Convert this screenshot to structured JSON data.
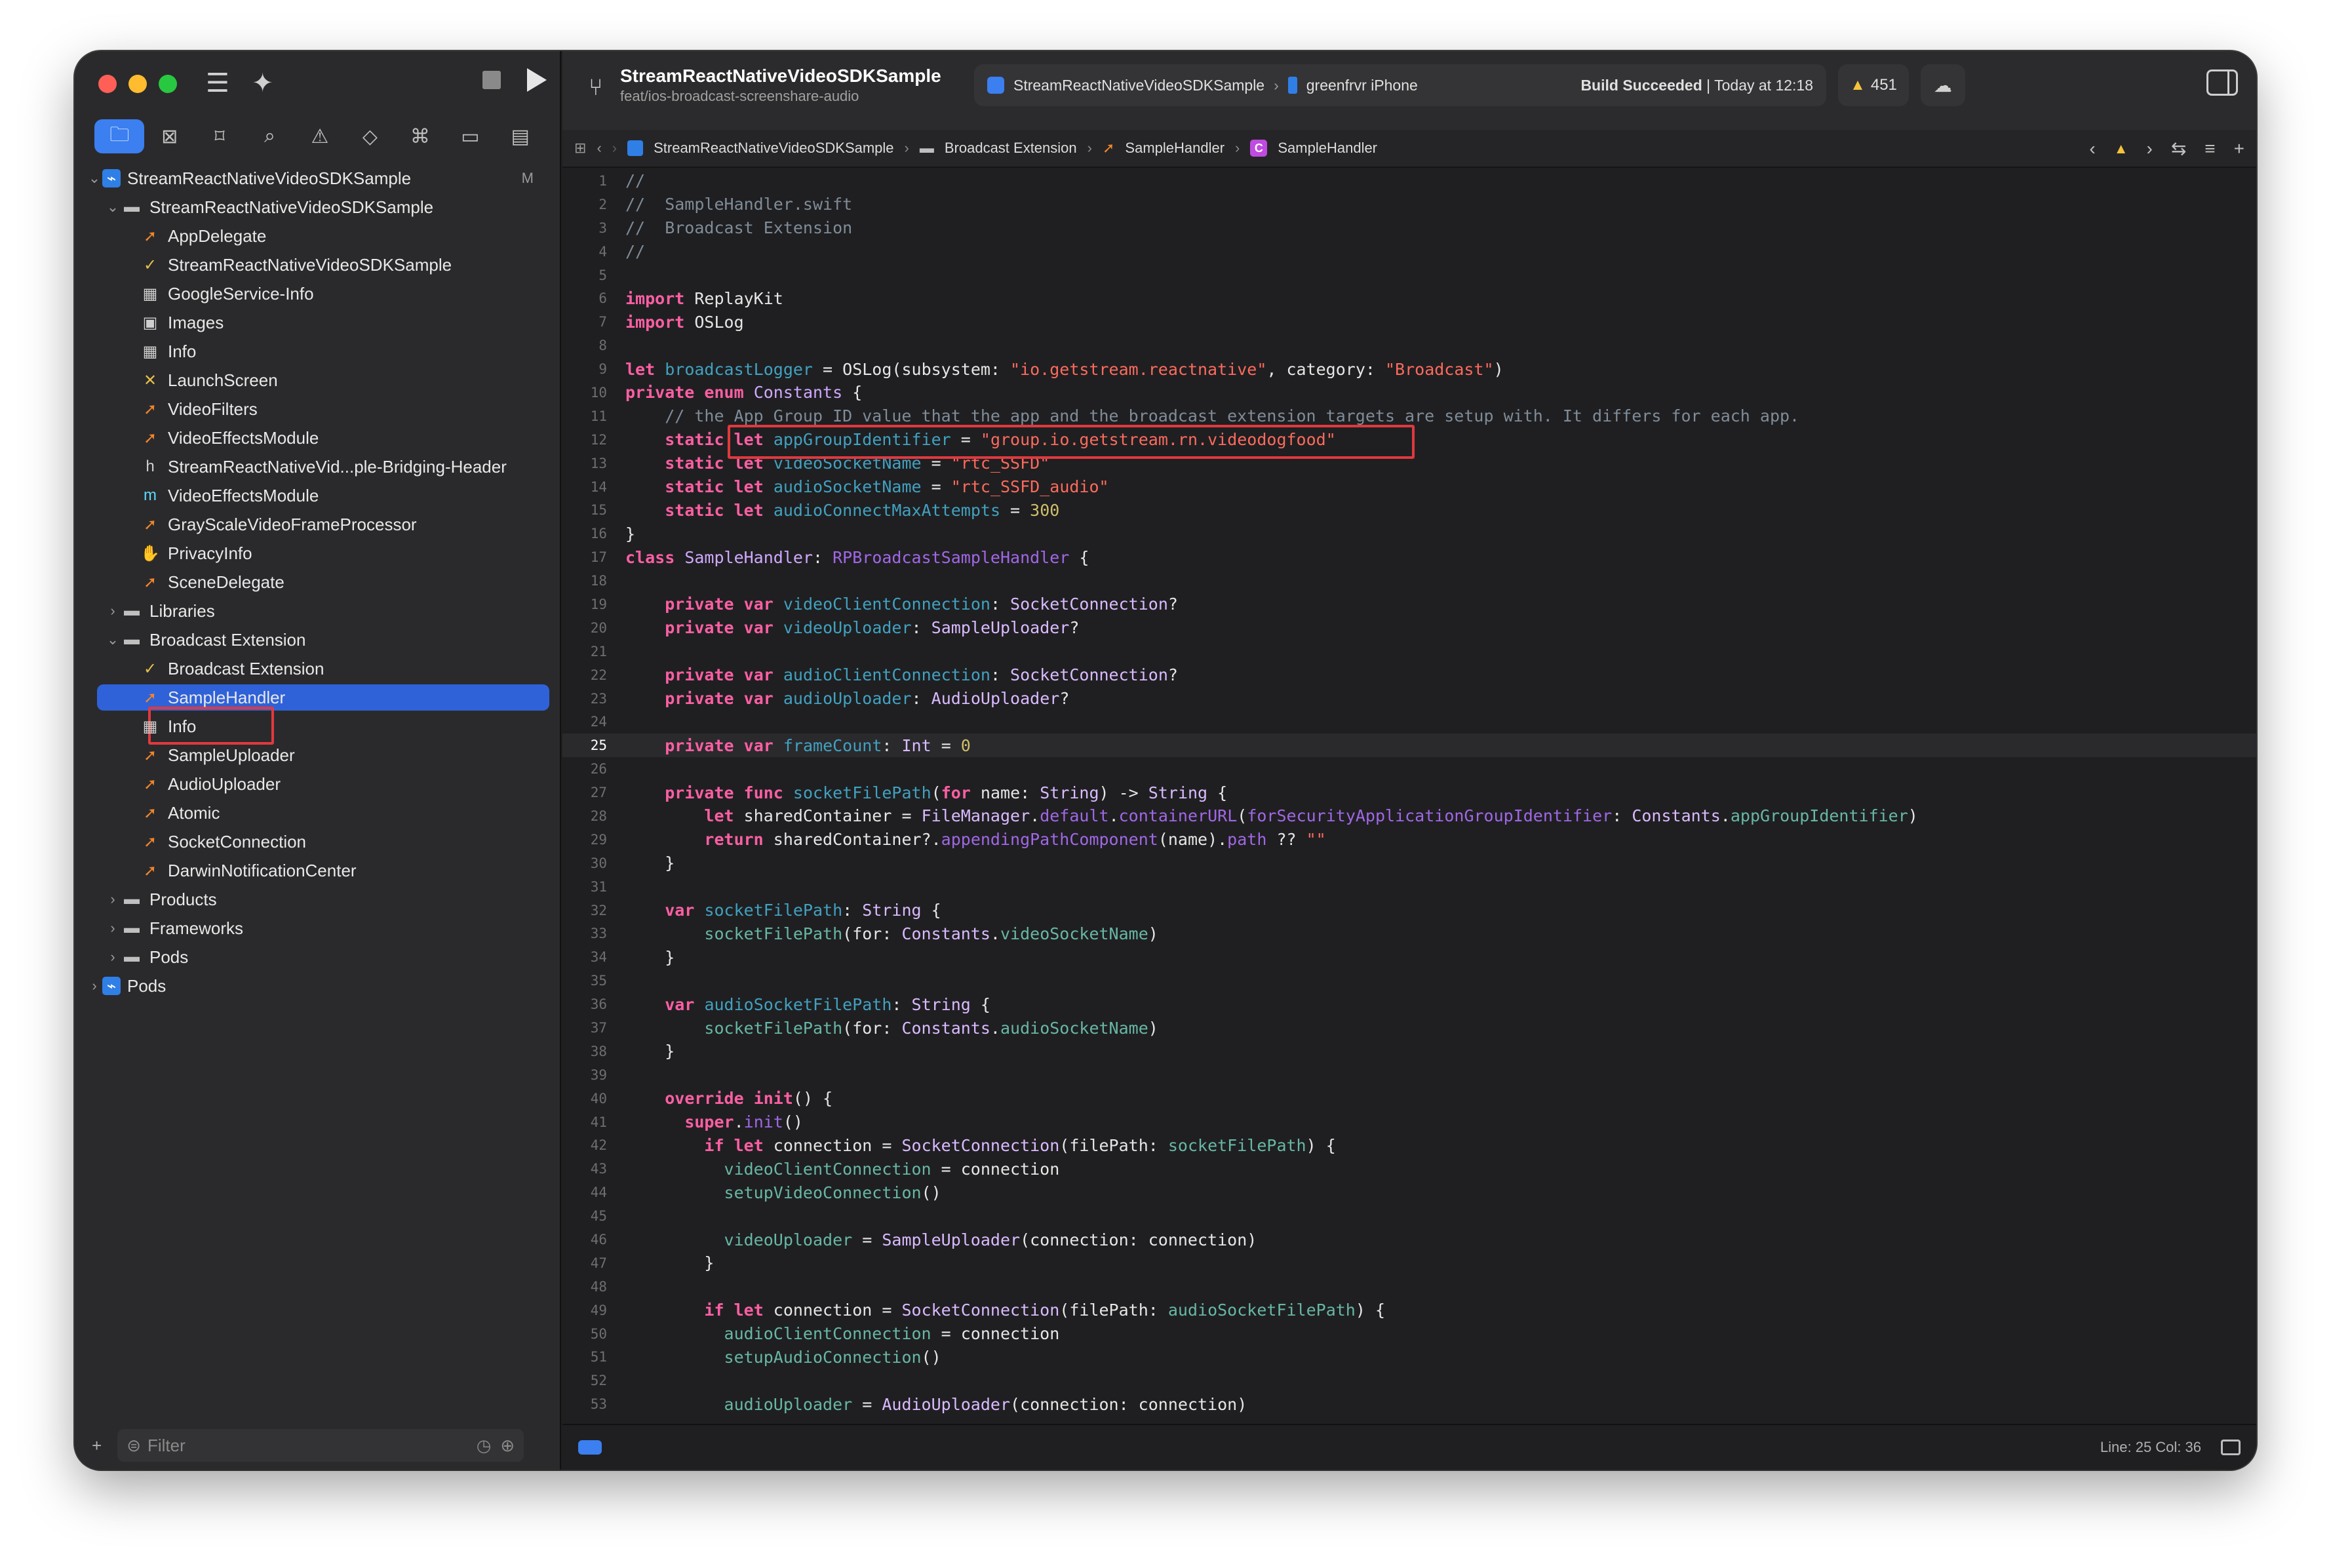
{
  "sidebar": {
    "nav_tabs": [
      {
        "icon": "folder-icon",
        "glyph": "🗀"
      },
      {
        "icon": "source-control-icon",
        "glyph": "⊠"
      },
      {
        "icon": "bookmark-icon",
        "glyph": "⌑"
      },
      {
        "icon": "find-icon",
        "glyph": "⌕"
      },
      {
        "icon": "issue-icon",
        "glyph": "⚠"
      },
      {
        "icon": "test-icon",
        "glyph": "◇"
      },
      {
        "icon": "debug-icon",
        "glyph": "⌘"
      },
      {
        "icon": "breakpoint-icon",
        "glyph": "▭"
      },
      {
        "icon": "report-icon",
        "glyph": "▤"
      }
    ],
    "tree": [
      {
        "label": "StreamReactNativeVideoSDKSample",
        "depth": 0,
        "chev": "⌄",
        "icon": "project-icon",
        "badge": "M"
      },
      {
        "label": "StreamReactNativeVideoSDKSample",
        "depth": 1,
        "chev": "⌄",
        "icon": "folder-icon"
      },
      {
        "label": "AppDelegate",
        "depth": 2,
        "chev": "",
        "icon": "swift-icon"
      },
      {
        "label": "StreamReactNativeVideoSDKSample",
        "depth": 2,
        "chev": "",
        "icon": "entitlements-icon"
      },
      {
        "label": "GoogleService-Info",
        "depth": 2,
        "chev": "",
        "icon": "plist-icon"
      },
      {
        "label": "Images",
        "depth": 2,
        "chev": "",
        "icon": "assets-icon"
      },
      {
        "label": "Info",
        "depth": 2,
        "chev": "",
        "icon": "plist-icon"
      },
      {
        "label": "LaunchScreen",
        "depth": 2,
        "chev": "",
        "icon": "storyboard-icon"
      },
      {
        "label": "VideoFilters",
        "depth": 2,
        "chev": "",
        "icon": "swift-icon"
      },
      {
        "label": "VideoEffectsModule",
        "depth": 2,
        "chev": "",
        "icon": "swift-icon"
      },
      {
        "label": "StreamReactNativeVid...ple-Bridging-Header",
        "depth": 2,
        "chev": "",
        "icon": "header-icon"
      },
      {
        "label": "VideoEffectsModule",
        "depth": 2,
        "chev": "",
        "icon": "objc-icon"
      },
      {
        "label": "GrayScaleVideoFrameProcessor",
        "depth": 2,
        "chev": "",
        "icon": "swift-icon"
      },
      {
        "label": "PrivacyInfo",
        "depth": 2,
        "chev": "",
        "icon": "privacy-icon"
      },
      {
        "label": "SceneDelegate",
        "depth": 2,
        "chev": "",
        "icon": "swift-icon"
      },
      {
        "label": "Libraries",
        "depth": 1,
        "chev": "›",
        "icon": "folder-icon"
      },
      {
        "label": "Broadcast Extension",
        "depth": 1,
        "chev": "⌄",
        "icon": "folder-icon"
      },
      {
        "label": "Broadcast Extension",
        "depth": 2,
        "chev": "",
        "icon": "entitlements-icon"
      },
      {
        "label": "SampleHandler",
        "depth": 2,
        "chev": "",
        "icon": "swift-icon",
        "selected": true
      },
      {
        "label": "Info",
        "depth": 2,
        "chev": "",
        "icon": "plist-icon"
      },
      {
        "label": "SampleUploader",
        "depth": 2,
        "chev": "",
        "icon": "swift-icon"
      },
      {
        "label": "AudioUploader",
        "depth": 2,
        "chev": "",
        "icon": "swift-icon"
      },
      {
        "label": "Atomic",
        "depth": 2,
        "chev": "",
        "icon": "swift-icon"
      },
      {
        "label": "SocketConnection",
        "depth": 2,
        "chev": "",
        "icon": "swift-icon"
      },
      {
        "label": "DarwinNotificationCenter",
        "depth": 2,
        "chev": "",
        "icon": "swift-icon"
      },
      {
        "label": "Products",
        "depth": 1,
        "chev": "›",
        "icon": "folder-icon"
      },
      {
        "label": "Frameworks",
        "depth": 1,
        "chev": "›",
        "icon": "folder-icon"
      },
      {
        "label": "Pods",
        "depth": 1,
        "chev": "›",
        "icon": "folder-icon"
      },
      {
        "label": "Pods",
        "depth": 0,
        "chev": "›",
        "icon": "project-icon"
      }
    ],
    "filter_placeholder": "Filter"
  },
  "toolbar": {
    "project_title": "StreamReactNativeVideoSDKSample",
    "branch": "feat/ios-broadcast-screenshare-audio",
    "scheme": "StreamReactNativeVideoSDKSample",
    "device": "greenfrvr iPhone",
    "build_status_bold": "Build Succeeded",
    "build_status_time": " | Today at 12:18",
    "warnings_count": "451"
  },
  "jumpbar": {
    "project": "StreamReactNativeVideoSDKSample",
    "folder": "Broadcast Extension",
    "file": "SampleHandler",
    "symbol": "SampleHandler",
    "symbol_badge": "C"
  },
  "editor": {
    "current_line": 25,
    "lines": [
      [
        [
          "cm",
          "//"
        ]
      ],
      [
        [
          "cm",
          "//  SampleHandler.swift"
        ]
      ],
      [
        [
          "cm",
          "//  Broadcast Extension"
        ]
      ],
      [
        [
          "cm",
          "//"
        ]
      ],
      [],
      [
        [
          "kw",
          "import"
        ],
        [
          "p",
          " ReplayKit"
        ]
      ],
      [
        [
          "kw",
          "import"
        ],
        [
          "p",
          " OSLog"
        ]
      ],
      [],
      [
        [
          "kw",
          "let"
        ],
        [
          "p",
          " "
        ],
        [
          "dec",
          "broadcastLogger"
        ],
        [
          "p",
          " = OSLog(subsystem: "
        ],
        [
          "str",
          "\"io.getstream.reactnative\""
        ],
        [
          "p",
          ", category: "
        ],
        [
          "str",
          "\"Broadcast\""
        ],
        [
          "p",
          ")"
        ]
      ],
      [
        [
          "kw",
          "private"
        ],
        [
          "p",
          " "
        ],
        [
          "kw",
          "enum"
        ],
        [
          "p",
          " "
        ],
        [
          "ty",
          "Constants"
        ],
        [
          "p",
          " {"
        ]
      ],
      [
        [
          "cm",
          "    // the App Group ID value that the app and the broadcast extension targets are setup with. It differs for each app."
        ]
      ],
      [
        [
          "p",
          "    "
        ],
        [
          "kw",
          "static"
        ],
        [
          "p",
          " "
        ],
        [
          "kw",
          "let"
        ],
        [
          "p",
          " "
        ],
        [
          "dec",
          "appGroupIdentifier"
        ],
        [
          "p",
          " = "
        ],
        [
          "str",
          "\"group.io.getstream.rn.videodogfood\""
        ]
      ],
      [
        [
          "p",
          "    "
        ],
        [
          "kw",
          "static"
        ],
        [
          "p",
          " "
        ],
        [
          "kw",
          "let"
        ],
        [
          "p",
          " "
        ],
        [
          "dec",
          "videoSocketName"
        ],
        [
          "p",
          " = "
        ],
        [
          "str",
          "\"rtc_SSFD\""
        ]
      ],
      [
        [
          "p",
          "    "
        ],
        [
          "kw",
          "static"
        ],
        [
          "p",
          " "
        ],
        [
          "kw",
          "let"
        ],
        [
          "p",
          " "
        ],
        [
          "dec",
          "audioSocketName"
        ],
        [
          "p",
          " = "
        ],
        [
          "str",
          "\"rtc_SSFD_audio\""
        ]
      ],
      [
        [
          "p",
          "    "
        ],
        [
          "kw",
          "static"
        ],
        [
          "p",
          " "
        ],
        [
          "kw",
          "let"
        ],
        [
          "p",
          " "
        ],
        [
          "dec",
          "audioConnectMaxAttempts"
        ],
        [
          "p",
          " = "
        ],
        [
          "num",
          "300"
        ]
      ],
      [
        [
          "p",
          "}"
        ]
      ],
      [
        [
          "kw",
          "class"
        ],
        [
          "p",
          " "
        ],
        [
          "ty",
          "SampleHandler"
        ],
        [
          "p",
          ": "
        ],
        [
          "tyd",
          "RPBroadcastSampleHandler"
        ],
        [
          "p",
          " {"
        ]
      ],
      [],
      [
        [
          "p",
          "    "
        ],
        [
          "kw",
          "private"
        ],
        [
          "p",
          " "
        ],
        [
          "kw",
          "var"
        ],
        [
          "p",
          " "
        ],
        [
          "dec",
          "videoClientConnection"
        ],
        [
          "p",
          ": "
        ],
        [
          "ty2",
          "SocketConnection"
        ],
        [
          "p",
          "?"
        ]
      ],
      [
        [
          "p",
          "    "
        ],
        [
          "kw",
          "private"
        ],
        [
          "p",
          " "
        ],
        [
          "kw",
          "var"
        ],
        [
          "p",
          " "
        ],
        [
          "dec",
          "videoUploader"
        ],
        [
          "p",
          ": "
        ],
        [
          "ty2",
          "SampleUploader"
        ],
        [
          "p",
          "?"
        ]
      ],
      [],
      [
        [
          "p",
          "    "
        ],
        [
          "kw",
          "private"
        ],
        [
          "p",
          " "
        ],
        [
          "kw",
          "var"
        ],
        [
          "p",
          " "
        ],
        [
          "dec",
          "audioClientConnection"
        ],
        [
          "p",
          ": "
        ],
        [
          "ty2",
          "SocketConnection"
        ],
        [
          "p",
          "?"
        ]
      ],
      [
        [
          "p",
          "    "
        ],
        [
          "kw",
          "private"
        ],
        [
          "p",
          " "
        ],
        [
          "kw",
          "var"
        ],
        [
          "p",
          " "
        ],
        [
          "dec",
          "audioUploader"
        ],
        [
          "p",
          ": "
        ],
        [
          "ty2",
          "AudioUploader"
        ],
        [
          "p",
          "?"
        ]
      ],
      [],
      [
        [
          "p",
          "    "
        ],
        [
          "kw",
          "private"
        ],
        [
          "p",
          " "
        ],
        [
          "kw",
          "var"
        ],
        [
          "p",
          " "
        ],
        [
          "dec",
          "frameCount"
        ],
        [
          "p",
          ": "
        ],
        [
          "ty2",
          "Int"
        ],
        [
          "p",
          " = "
        ],
        [
          "num",
          "0"
        ]
      ],
      [],
      [
        [
          "p",
          "    "
        ],
        [
          "kw",
          "private"
        ],
        [
          "p",
          " "
        ],
        [
          "kw",
          "func"
        ],
        [
          "p",
          " "
        ],
        [
          "dec",
          "socketFilePath"
        ],
        [
          "p",
          "("
        ],
        [
          "kw",
          "for"
        ],
        [
          "p",
          " name: "
        ],
        [
          "ty2",
          "String"
        ],
        [
          "p",
          ") -> "
        ],
        [
          "ty2",
          "String"
        ],
        [
          "p",
          " {"
        ]
      ],
      [
        [
          "p",
          "        "
        ],
        [
          "kw",
          "let"
        ],
        [
          "p",
          " sharedContainer = "
        ],
        [
          "ty2",
          "FileManager"
        ],
        [
          "p",
          "."
        ],
        [
          "fn",
          "default"
        ],
        [
          "p",
          "."
        ],
        [
          "fn",
          "containerURL"
        ],
        [
          "p",
          "("
        ],
        [
          "fn",
          "forSecurityApplicationGroupIdentifier"
        ],
        [
          "p",
          ": "
        ],
        [
          "ty2",
          "Constants"
        ],
        [
          "p",
          "."
        ],
        [
          "prop",
          "appGroupIdentifier"
        ],
        [
          "p",
          ")"
        ]
      ],
      [
        [
          "p",
          "        "
        ],
        [
          "kw",
          "return"
        ],
        [
          "p",
          " sharedContainer?."
        ],
        [
          "fn",
          "appendingPathComponent"
        ],
        [
          "p",
          "(name)."
        ],
        [
          "fn",
          "path"
        ],
        [
          "p",
          " ?? "
        ],
        [
          "str",
          "\"\""
        ]
      ],
      [
        [
          "p",
          "    }"
        ]
      ],
      [],
      [
        [
          "p",
          "    "
        ],
        [
          "kw",
          "var"
        ],
        [
          "p",
          " "
        ],
        [
          "dec",
          "socketFilePath"
        ],
        [
          "p",
          ": "
        ],
        [
          "ty2",
          "String"
        ],
        [
          "p",
          " {"
        ]
      ],
      [
        [
          "p",
          "        "
        ],
        [
          "prop",
          "socketFilePath"
        ],
        [
          "p",
          "(for: "
        ],
        [
          "ty2",
          "Constants"
        ],
        [
          "p",
          "."
        ],
        [
          "prop",
          "videoSocketName"
        ],
        [
          "p",
          ")"
        ]
      ],
      [
        [
          "p",
          "    }"
        ]
      ],
      [],
      [
        [
          "p",
          "    "
        ],
        [
          "kw",
          "var"
        ],
        [
          "p",
          " "
        ],
        [
          "dec",
          "audioSocketFilePath"
        ],
        [
          "p",
          ": "
        ],
        [
          "ty2",
          "String"
        ],
        [
          "p",
          " {"
        ]
      ],
      [
        [
          "p",
          "        "
        ],
        [
          "prop",
          "socketFilePath"
        ],
        [
          "p",
          "(for: "
        ],
        [
          "ty2",
          "Constants"
        ],
        [
          "p",
          "."
        ],
        [
          "prop",
          "audioSocketName"
        ],
        [
          "p",
          ")"
        ]
      ],
      [
        [
          "p",
          "    }"
        ]
      ],
      [],
      [
        [
          "p",
          "    "
        ],
        [
          "kw",
          "override"
        ],
        [
          "p",
          " "
        ],
        [
          "kw",
          "init"
        ],
        [
          "p",
          "() {"
        ]
      ],
      [
        [
          "p",
          "      "
        ],
        [
          "kw",
          "super"
        ],
        [
          "p",
          "."
        ],
        [
          "fn",
          "init"
        ],
        [
          "p",
          "()"
        ]
      ],
      [
        [
          "p",
          "        "
        ],
        [
          "kw",
          "if"
        ],
        [
          "p",
          " "
        ],
        [
          "kw",
          "let"
        ],
        [
          "p",
          " connection = "
        ],
        [
          "ty2",
          "SocketConnection"
        ],
        [
          "p",
          "(filePath: "
        ],
        [
          "prop",
          "socketFilePath"
        ],
        [
          "p",
          ") {"
        ]
      ],
      [
        [
          "p",
          "          "
        ],
        [
          "prop",
          "videoClientConnection"
        ],
        [
          "p",
          " = connection"
        ]
      ],
      [
        [
          "p",
          "          "
        ],
        [
          "prop",
          "setupVideoConnection"
        ],
        [
          "p",
          "()"
        ]
      ],
      [],
      [
        [
          "p",
          "          "
        ],
        [
          "prop",
          "videoUploader"
        ],
        [
          "p",
          " = "
        ],
        [
          "ty2",
          "SampleUploader"
        ],
        [
          "p",
          "(connection: connection)"
        ]
      ],
      [
        [
          "p",
          "        }"
        ]
      ],
      [],
      [
        [
          "p",
          "        "
        ],
        [
          "kw",
          "if"
        ],
        [
          "p",
          " "
        ],
        [
          "kw",
          "let"
        ],
        [
          "p",
          " connection = "
        ],
        [
          "ty2",
          "SocketConnection"
        ],
        [
          "p",
          "(filePath: "
        ],
        [
          "prop",
          "audioSocketFilePath"
        ],
        [
          "p",
          ") {"
        ]
      ],
      [
        [
          "p",
          "          "
        ],
        [
          "prop",
          "audioClientConnection"
        ],
        [
          "p",
          " = connection"
        ]
      ],
      [
        [
          "p",
          "          "
        ],
        [
          "prop",
          "setupAudioConnection"
        ],
        [
          "p",
          "()"
        ]
      ],
      [],
      [
        [
          "p",
          "          "
        ],
        [
          "prop",
          "audioUploader"
        ],
        [
          "p",
          " = "
        ],
        [
          "ty2",
          "AudioUploader"
        ],
        [
          "p",
          "(connection: connection)"
        ]
      ]
    ]
  },
  "statusbar": {
    "position": "Line: 25  Col: 36"
  }
}
